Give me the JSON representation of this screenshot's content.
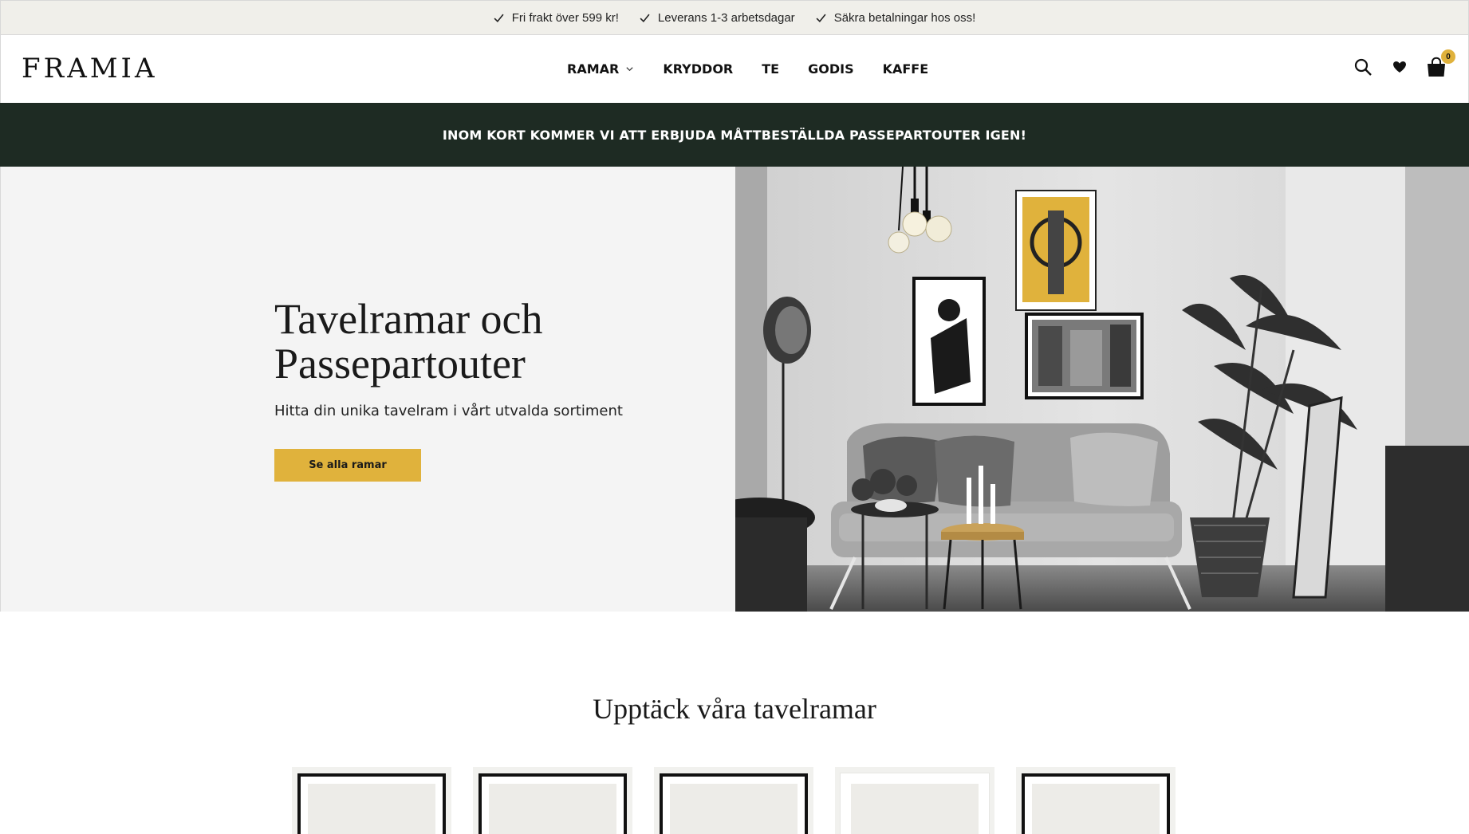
{
  "usp": [
    {
      "label": "Fri frakt över 599 kr!"
    },
    {
      "label": "Leverans 1-3 arbetsdagar"
    },
    {
      "label": "Säkra betalningar hos oss!"
    }
  ],
  "header": {
    "logo": "FRAMIA",
    "nav": [
      {
        "label": "RAMAR",
        "has_dropdown": true
      },
      {
        "label": "KRYDDOR"
      },
      {
        "label": "TE"
      },
      {
        "label": "GODIS"
      },
      {
        "label": "KAFFE"
      }
    ],
    "icons": [
      "search-icon",
      "heart-icon",
      "cart-icon"
    ],
    "cart_count": "0"
  },
  "announcement": "INOM KORT KOMMER VI ATT ERBJUDA MÅTTBESTÄLLDA PASSEPARTOUTER IGEN!",
  "hero": {
    "title_line1": "Tavelramar och",
    "title_line2": "Passepartouter",
    "subtitle": "Hitta din unika tavelram i vårt utvalda sortiment",
    "button_label": "Se alla ramar"
  },
  "section": {
    "title": "Upptäck våra tavelramar",
    "frame_colors": [
      "black",
      "black",
      "black",
      "white",
      "black"
    ]
  },
  "colors": {
    "accent": "#e0b23c",
    "announcement_bg": "#1e2b23",
    "usp_bg": "#f0efea",
    "hero_bg": "#f4f4f4"
  }
}
